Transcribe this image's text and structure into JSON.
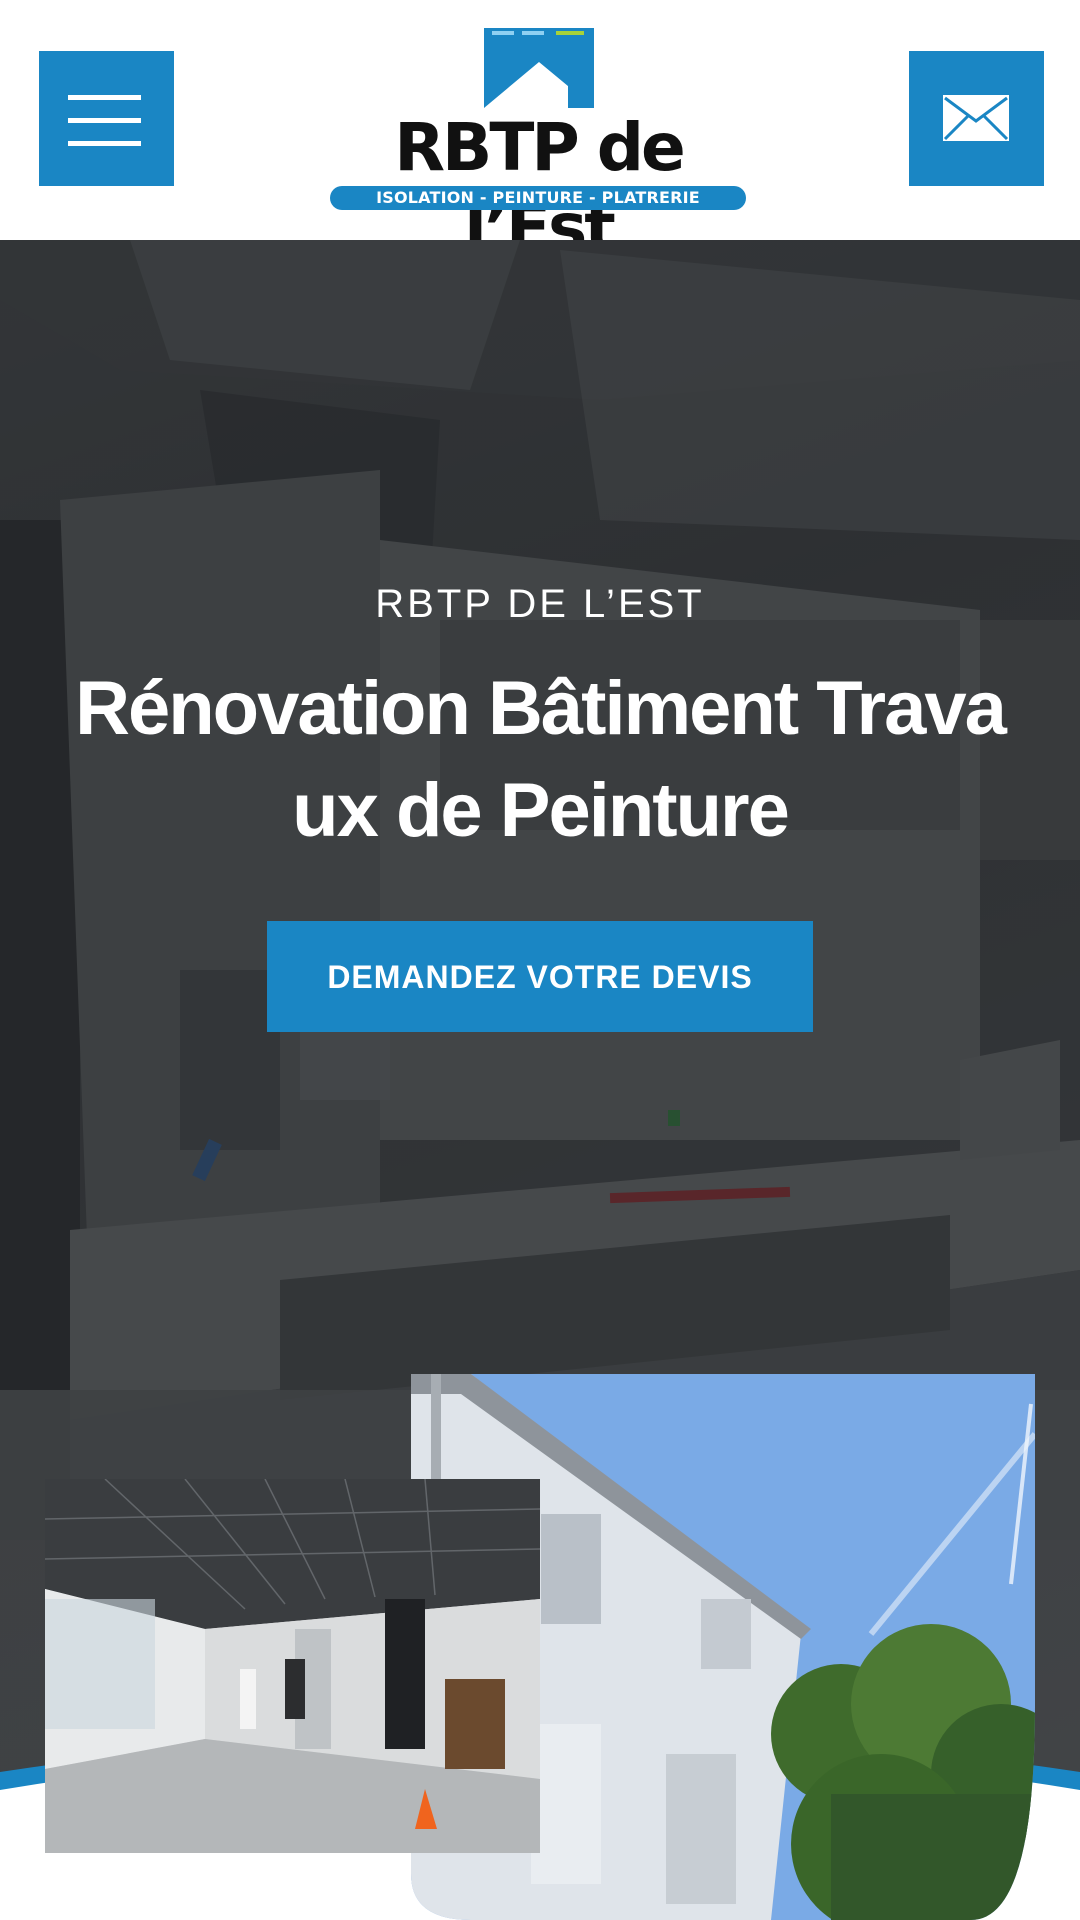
{
  "header": {
    "menu_icon": "hamburger-menu-icon",
    "mail_icon": "envelope-icon",
    "logo": {
      "name": "RBTP de l’Est",
      "tagline": "ISOLATION - PEINTURE - PLATRERIE"
    }
  },
  "hero": {
    "eyebrow": "RBTP DE L’EST",
    "title": "Rénovation Bâtiment Travaux de Peinture",
    "cta_label": "DEMANDEZ VOTRE DEVIS"
  },
  "colors": {
    "brand_blue": "#1a86c4",
    "header_bg": "#ffffff",
    "text_light": "#ffffff"
  }
}
